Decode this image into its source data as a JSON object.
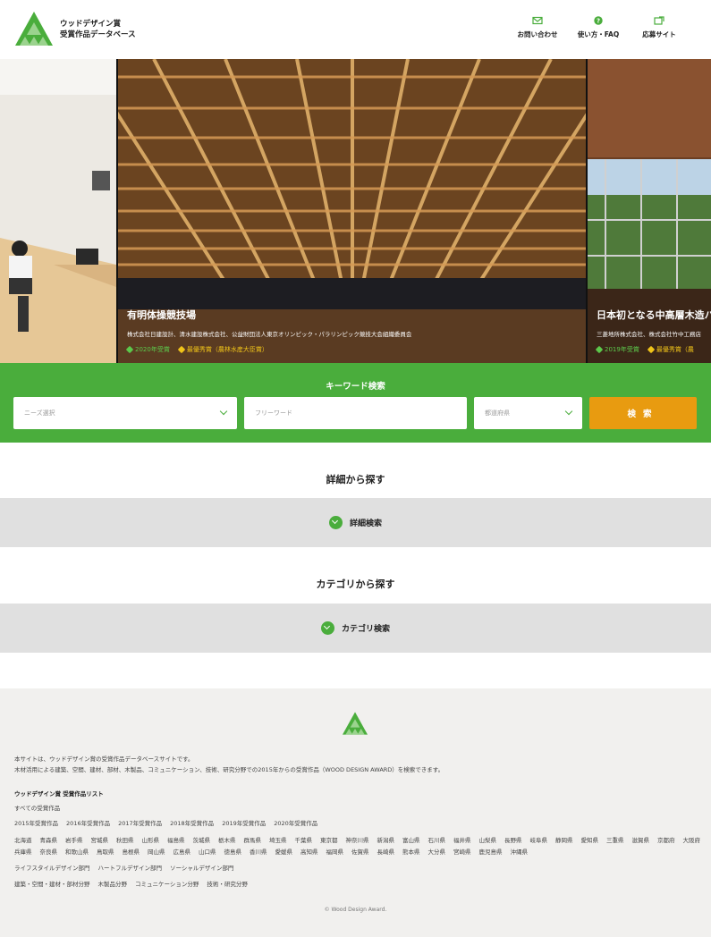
{
  "site": {
    "title_line1": "ウッドデザイン賞",
    "title_line2": "受賞作品データベース"
  },
  "nav": [
    {
      "label": "お問い合わせ",
      "icon": "mail-icon"
    },
    {
      "label": "使い方・FAQ",
      "icon": "help-icon"
    },
    {
      "label": "応募サイト",
      "icon": "external-link-icon"
    }
  ],
  "carousel": {
    "main": {
      "title": "有明体操競技場",
      "subtitle": "株式会社日建設計、清水建設株式会社、公益財団法人東京オリンピック・パラリンピック競技大会組織委員会",
      "tags": [
        {
          "label": "2020年受賞",
          "color": "#4aad3c"
        },
        {
          "label": "最優秀賞（農林水産大臣賞）",
          "color": "#f0c419"
        }
      ]
    },
    "right": {
      "title": "日本初となる中高層木造ハ",
      "subtitle": "三菱地所株式会社、株式会社竹中工務店",
      "tags": [
        {
          "label": "2019年受賞",
          "color": "#4aad3c"
        },
        {
          "label": "最優秀賞（農",
          "color": "#f0c419"
        }
      ]
    }
  },
  "search": {
    "title": "キーワード検索",
    "needs_placeholder": "ニーズ選択",
    "keyword_placeholder": "フリーワード",
    "pref_placeholder": "都道府県",
    "button": "検索"
  },
  "detail": {
    "heading": "詳細から探す",
    "toggle": "詳細検索"
  },
  "category": {
    "heading": "カテゴリから探す",
    "toggle": "カテゴリ検索"
  },
  "footer": {
    "desc1": "本サイトは、ウッドデザイン賞の受賞作品データベースサイトです。",
    "desc2": "木材活用による建築、空間、建材、部材、木製品、コミュニケーション、技術、研究分野での2015年からの受賞作品（WOOD DESIGN AWARD）を検索できます。",
    "list_title": "ウッドデザイン賞 受賞作品リスト",
    "all_link": "すべての受賞作品",
    "years": [
      "2015年受賞作品",
      "2016年受賞作品",
      "2017年受賞作品",
      "2018年受賞作品",
      "2019年受賞作品",
      "2020年受賞作品"
    ],
    "prefectures": [
      "北海道",
      "青森県",
      "岩手県",
      "宮城県",
      "秋田県",
      "山形県",
      "福島県",
      "茨城県",
      "栃木県",
      "群馬県",
      "埼玉県",
      "千葉県",
      "東京都",
      "神奈川県",
      "新潟県",
      "富山県",
      "石川県",
      "福井県",
      "山梨県",
      "長野県",
      "岐阜県",
      "静岡県",
      "愛知県",
      "三重県",
      "滋賀県",
      "京都府",
      "大阪府",
      "兵庫県",
      "奈良県",
      "和歌山県",
      "鳥取県",
      "島根県",
      "岡山県",
      "広島県",
      "山口県",
      "徳島県",
      "香川県",
      "愛媛県",
      "高知県",
      "福岡県",
      "佐賀県",
      "長崎県",
      "熊本県",
      "大分県",
      "宮崎県",
      "鹿児島県",
      "沖縄県"
    ],
    "departments": [
      "ライフスタイルデザイン部門",
      "ハートフルデザイン部門",
      "ソーシャルデザイン部門"
    ],
    "fields": [
      "建築・空間・建材・部材分野",
      "木製品分野",
      "コミュニケーション分野",
      "技術・研究分野"
    ],
    "copyright": "© Wood Design Award."
  }
}
